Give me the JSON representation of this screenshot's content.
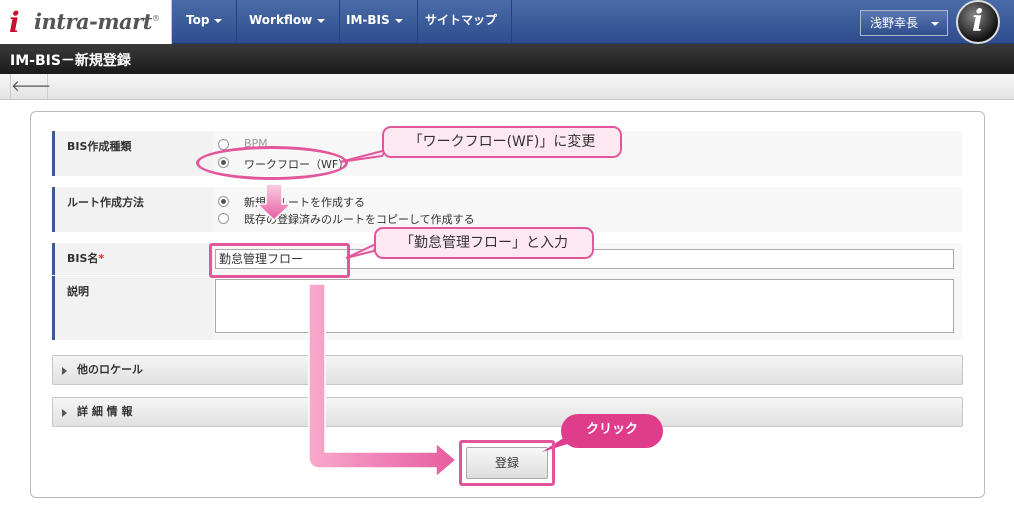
{
  "header": {
    "logo_text": "intra-mart",
    "logo_reg": "®",
    "nav": [
      {
        "label": "Top"
      },
      {
        "label": "Workflow"
      },
      {
        "label": "IM-BIS"
      },
      {
        "label": "サイトマップ"
      }
    ],
    "user": "浅野幸長",
    "avatar_letter": "i"
  },
  "page": {
    "title": "IM-BIS－新規登録",
    "back_glyph": "🡐"
  },
  "form": {
    "bis_type": {
      "label": "BIS作成種類",
      "options": [
        {
          "label": "BPM",
          "checked": false
        },
        {
          "label": "ワークフロー（WF）",
          "checked": true
        }
      ]
    },
    "route_method": {
      "label": "ルート作成方法",
      "options": [
        {
          "label": "新規にルートを作成する",
          "checked": true
        },
        {
          "label": "既存の登録済みのルートをコピーして作成する",
          "checked": false
        }
      ]
    },
    "bis_name": {
      "label": "BIS名",
      "required_mark": "*",
      "value": "勤怠管理フロー"
    },
    "description": {
      "label": "説明",
      "value": ""
    },
    "other_locale": {
      "label": "他のロケール"
    },
    "details": {
      "label": "詳 細 情 報"
    },
    "submit_label": "登録"
  },
  "annotations": {
    "callout_wf": "「ワークフロー(WF)」に変更",
    "callout_name": "「勤怠管理フロー」と入力",
    "click_badge": "クリック",
    "accent_color": "#e2579b"
  }
}
